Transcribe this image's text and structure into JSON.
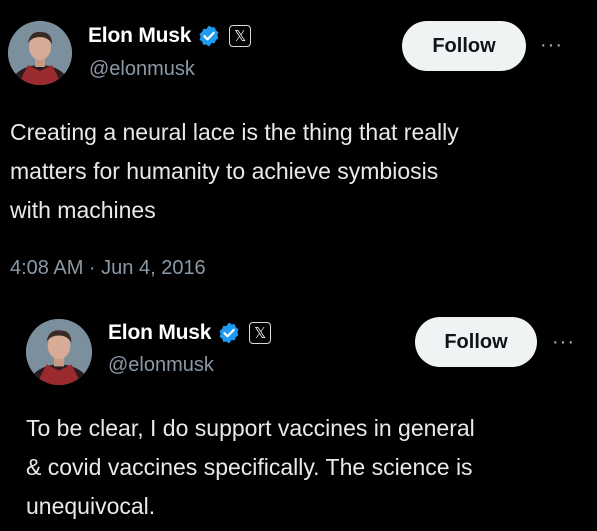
{
  "tweets": [
    {
      "author": {
        "name": "Elon Musk",
        "handle": "@elonmusk",
        "badge_text": "𝕏"
      },
      "follow_label": "Follow",
      "more_label": "···",
      "text_lines": [
        "Creating a neural lace is the thing that really",
        "matters for humanity to achieve symbiosis",
        "with machines"
      ],
      "timestamp": "4:08 AM · Jun 4, 2016"
    },
    {
      "author": {
        "name": "Elon Musk",
        "handle": "@elonmusk",
        "badge_text": "𝕏"
      },
      "follow_label": "Follow",
      "more_label": "···",
      "text_lines": [
        "To be clear, I do support vaccines in general",
        "& covid vaccines specifically. The science is",
        "unequivocal."
      ]
    }
  ],
  "colors": {
    "background": "#000000",
    "text_primary": "#e7e9ea",
    "text_secondary": "#8b98a5",
    "verified_blue": "#1d9bf0",
    "follow_button_bg": "#eff3f4",
    "follow_button_text": "#0f1419"
  },
  "icons": {
    "verified": "verified-badge-icon",
    "x_logo": "x-logo-icon",
    "more": "more-options-icon",
    "avatar": "profile-avatar"
  }
}
